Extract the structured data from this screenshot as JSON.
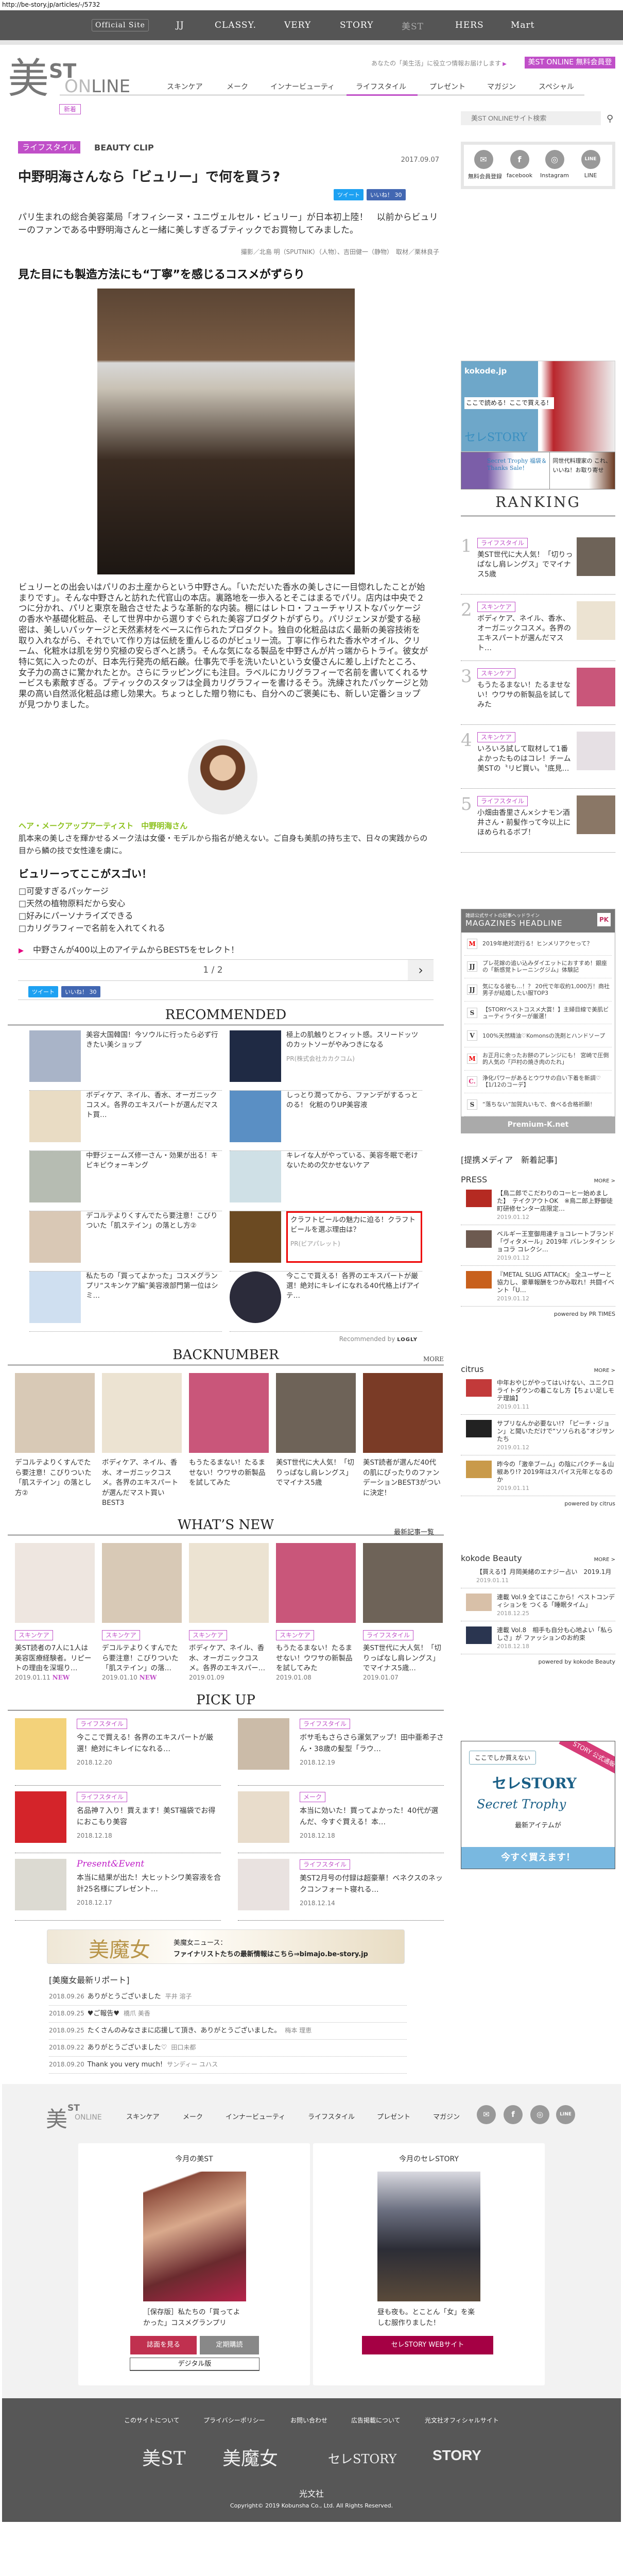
{
  "url": "http://be-story.jp/articles/-/5732",
  "topbar": {
    "official": "Official Site",
    "sites": [
      "JJ",
      "CLASSY.",
      "VERY",
      "STORY",
      "美ST",
      "HERS",
      "Mart"
    ]
  },
  "header": {
    "logo": {
      "bi": "美",
      "st": "ST",
      "on": "ON",
      "line": "LINE"
    },
    "tagline": "あなたの「美生活」に役立つ情報お届けします",
    "register": "美ST ONLINE 無料会員登録",
    "nav": [
      "スキンケア",
      "メーク",
      "インナービューティ",
      "ライフスタイル",
      "プレゼント",
      "マガジン",
      "スペシャル"
    ],
    "active_nav": "ライフスタイル",
    "new_tag": "新着",
    "search_placeholder": "美ST ONLINEサイト検索"
  },
  "social": [
    {
      "icon": "✉",
      "label": "無料会員登録"
    },
    {
      "icon": "f",
      "label": "facebook"
    },
    {
      "icon": "◎",
      "label": "Instagram"
    },
    {
      "icon": "LINE",
      "label": "LINE"
    }
  ],
  "article": {
    "category": "ライフスタイル",
    "series": "BEAUTY CLIP",
    "date": "2017.09.07",
    "title": "中野明海さんなら「ビュリー」で何を買う?",
    "tweet": "ツイート",
    "like": "いいね！ 30",
    "lead": "パリ生まれの総合美容薬局「オフィシーヌ・ユニヴェルセル・ビュリー」が日本初上陸！　以前からビュリーのファンである中野明海さんと一緒に美しすぎるブティックでお買物してみました。",
    "credit": "撮影／北島 明（SPUTNIK）（人物）、吉田健一（静物）　取材／栗林良子",
    "h2": "見た目にも製造方法にも“丁寧”を感じるコスメがずらり",
    "body": "ビュリーとの出会いはパリのお土産からという中野さん。「いただいた香水の美しさに一目惚れしたことが始まりです」。そんな中野さんと訪れた代官山の本店。裏路地を一歩入るとそこはまるでパリ。店内は中央で２つに分かれ、パリと東京を融合させたような革新的な内装。棚にはレトロ・フューチャリストなパッケージの香水や基礎化粧品、そして世界中から選りすぐられた美容プロダクトがずらり。パリジェンヌが愛する秘密は、美しいパッケージと天然素材をベースに作られたプロダクト。独自の化粧品は広く最新の美容技術を取り入れながら、それでいて作り方は伝統を重んじるのがビュリー流。丁寧に作られた香水やオイル、クリーム、化粧水は肌を労り究極の安らぎへと誘う。そんな気になる製品を中野さんが片っ端からトライ。彼女が特に気に入ったのが、日本先行発売の紙石鹸。仕事先で手を洗いたいという女優さんに差し上げたところ、女子力の高さに驚かれたとか。さらにラッピングにも注目。ラベルにカリグラフィーで名前を書いてくれるサービスも素敵すぎる。ブティックのスタッフは全員カリグラフィーを書けるそう。洗練されたパッケージと効果の高い自然派化粧品は癒し効果大。ちょっとした贈り物にも、自分へのご褒美にも、新しい定番ショップが見つかりました。",
    "profile_name": "ヘア・メークアップアーティスト　中野明海さん",
    "profile_desc": "肌本来の美しさを輝かせるメーク法は女優・モデルから指名が絶えない。ご自身も美肌の持ち主で、日々の実践からの目から鱗の技で女性達を虜に。",
    "h3": "ビュリーってここがスゴい！",
    "checklist": [
      "□可愛すぎるパッケージ",
      "□天然の植物原料だから安心",
      "□好みにパーソナライズできる",
      "□カリグラフィーで名前を入れてくれる"
    ],
    "next_link": "中野さんが400以上のアイテムからBEST5をセレクト！",
    "pager": "1 / 2",
    "next_icon": "›"
  },
  "recommended": {
    "title": "RECOMMENDED",
    "items": [
      {
        "t": "美容大国韓国！今ソウルに行ったら必ず行きたい美ショップ",
        "c": "#a9b4c8"
      },
      {
        "t": "極上の肌触りとフィット感。スリードッツのカットソーがやみつきになる",
        "pr": "PR(株式会社カカクコム)",
        "c": "#1f2a44"
      },
      {
        "t": "ボディケア、ネイル、香水、オーガニックコスメ。各界のエキスパートが選んだマスト買…",
        "c": "#e9dcc4"
      },
      {
        "t": "しっとり潤ってから、ファンデがするっとのる！ 化粧のりUP美容液",
        "c": "#5a8fc4"
      },
      {
        "t": "中野ジェームズ修一さん・効果が出る！キビキビウォーキング",
        "c": "#b6bcb2"
      },
      {
        "t": "キレイな人がやっている、美容冬眠で老けないための欠かせないケア",
        "c": "#cfe0e6"
      },
      {
        "t": "デコルテよりくすんでたら要注意！こびりついた「肌ステイン」の落とし方②",
        "c": "#d9c8b5"
      },
      {
        "t": "クラフトビールの魅力に迫る！クラフトビールを選ぶ理由は？",
        "pr": "PR(ビアパレット)",
        "c": "#6b4a22",
        "highlight": true
      },
      {
        "t": "私たちの「買ってよかった」コスメグランプリ“スキンケア編”美容液部門第一位はシミ…",
        "c": "#cfdff0"
      },
      {
        "t": "今ここで買える！各界のエキスパートが厳選！絶対にキレイになれる40代格上げアイテ…",
        "c": "#2b2b3a",
        "round": true
      }
    ],
    "by": "Recommended by",
    "by_brand": "LOGLY"
  },
  "backnumber": {
    "title": "BACKNUMBER",
    "more": "MORE",
    "items": [
      {
        "t": "デコルテよりくすんでたら要注意！こびりついた「肌ステイン」の落とし方②",
        "c": "#d8c9b6"
      },
      {
        "t": "ボディケア、ネイル、香水、オーガニックコスメ。各界のエキスパートが選んだマスト買いBEST3",
        "c": "#ece3d2"
      },
      {
        "t": "もうたるまない！たるませない！ウワサの新製品を試してみた",
        "c": "#c9567a"
      },
      {
        "t": "美ST世代に大人気！「切りっぱなし肩レングス」でマイナス5歳",
        "c": "#6e6358"
      },
      {
        "t": "美ST読者が選んだ40代の肌にぴったりのファンデーションBEST3がついに決定！",
        "c": "#7a3b26"
      }
    ]
  },
  "whatsnew": {
    "title": "WHAT’S NEW",
    "more": "最新記事一覧",
    "new_label": "NEW",
    "items": [
      {
        "tag": "スキンケア",
        "t": "美ST読者の7人に1人は美容医療経験者。リピートの理由を深堀り…",
        "d": "2019.01.11",
        "isnew": true,
        "c": "#eee6e0"
      },
      {
        "tag": "スキンケア",
        "t": "デコルテよりくすんでたら要注意！こびりついた「肌ステイン」の落…",
        "d": "2019.01.10",
        "isnew": true,
        "c": "#d8c9b6"
      },
      {
        "tag": "スキンケア",
        "t": "ボディケア、ネイル、香水、オーガニックコスメ。各界のエキスパー…",
        "d": "2019.01.09",
        "c": "#ece3d2"
      },
      {
        "tag": "スキンケア",
        "t": "もうたるまない！たるませない！ウワサの新製品を試してみた",
        "d": "2019.01.08",
        "c": "#c9567a"
      },
      {
        "tag": "ライフスタイル",
        "t": "美ST世代に大人気！「切りっぱなし肩レングス」でマイナス5歳…",
        "d": "2019.01.07",
        "c": "#6e6358"
      }
    ]
  },
  "pickup": {
    "title": "PICK UP",
    "items": [
      {
        "tag": "ライフスタイル",
        "t": "今ここで買える！各界のエキスパートが厳選！絶対にキレイになれる…",
        "d": "2018.12.20",
        "c": "#f3d27a"
      },
      {
        "tag": "ライフスタイル",
        "t": "ボサ毛もさらさら運気アップ！田中亜希子さん・38歳の髪型「ラウ…",
        "d": "2018.12.19",
        "c": "#cbbba8"
      },
      {
        "tag": "ライフスタイル",
        "t": "名品神７入り！買えます！美ST福袋でお得におこもり美容",
        "d": "2018.12.18",
        "c": "#d4242a"
      },
      {
        "tag": "メーク",
        "t": "本当に効いた！買ってよかった！40代が選んだ、今すぐ買える！本…",
        "d": "2018.12.18",
        "c": "#e8dccb"
      },
      {
        "pe": "Present&Event",
        "t": "本当に結果が出た！大ヒットシワ美容液を合計25名様にプレゼント…",
        "d": "2018.12.17",
        "c": "#dcdad2"
      },
      {
        "tag": "ライフスタイル",
        "t": "美ST2月号の付録は超豪華！ベネクスのネックコンフォート寝れる…",
        "d": "2018.12.14",
        "c": "#e9e2e0"
      }
    ]
  },
  "bimajo": {
    "logo": "美魔女",
    "news": "美魔女ニュース：",
    "link": "ファイナリストたちの最新情報はこちら⇒bimajo.be-story.jp"
  },
  "reports": {
    "title": "[美魔女最新リポート]",
    "items": [
      {
        "d": "2018.09.26",
        "t": "ありがとうございました",
        "a": "平井 溶子"
      },
      {
        "d": "2018.09.25",
        "t": "♥ご報告♥",
        "a": "橋爪 美香"
      },
      {
        "d": "2018.09.25",
        "t": "たくさんのみなさまに応援して頂き、ありがとうございました。",
        "a": "梅本 理恵"
      },
      {
        "d": "2018.09.22",
        "t": "ありがとうございました♡",
        "a": "田口未都"
      },
      {
        "d": "2018.09.20",
        "t": "Thank you very much!",
        "a": "サンディー ユハス"
      }
    ]
  },
  "sidebar": {
    "ad1": {
      "k": "kokode.jp",
      "k2": "ここで読める！ここで買える！",
      "k3": "セレSTORY"
    },
    "ad2": {
      "a1": "Secret Trophy 福袋＆Thanks Sale！",
      "a2": "同世代料理家の これ、いいね！お取り寄せ"
    },
    "ranking_title": "RANKING",
    "ranking": [
      {
        "n": "1",
        "tag": "ライフスタイル",
        "t": "美ST世代に大人気！「切りっぱなし肩レングス」でマイナス5歳",
        "c": "#6e6358"
      },
      {
        "n": "2",
        "tag": "スキンケア",
        "t": "ボディケア、ネイル、香水、オーガニックコスメ。各界のエキスパートが選んだマスト…",
        "c": "#ece3d2"
      },
      {
        "n": "3",
        "tag": "スキンケア",
        "t": "もうたるまない！たるませない！ウワサの新製品を試してみた",
        "c": "#c9567a"
      },
      {
        "n": "4",
        "tag": "スキンケア",
        "t": "いろいろ試して取材して1番よかったものはコレ！チーム美STの〝リピ買い〟〝底見…",
        "c": "#e6e0e4"
      },
      {
        "n": "5",
        "tag": "ライフスタイル",
        "t": "小畑由香里さん×シナモン酒井さん・前髪作って今以上にほめられるボブ！",
        "c": "#8a7766"
      }
    ],
    "magazines": {
      "sub": "雑誌公式サイトの記事ヘッドライン",
      "title": "MAGAZINES HEADLINE",
      "badge": "PK",
      "items": [
        {
          "ic": "M",
          "col": "#e00",
          "t": "2019年絶対流行る！ヒンメリアクセって？"
        },
        {
          "ic": "JJ",
          "col": "#333",
          "t": "プレ花嫁の追い込みダイエットにおすすめ！銀座の「新感覚トレーニングジム」体験記"
        },
        {
          "ic": "JJ",
          "col": "#333",
          "t": "気になる彼も…！？ 20代で年収約1,000万！商社男子が結婚したい服TOP3"
        },
        {
          "ic": "S",
          "col": "#333",
          "t": "【STORYベストコスメ大賞！】主婦目線で美肌ビューティライターが厳選！"
        },
        {
          "ic": "V",
          "col": "#333",
          "t": "100%天然精油♡Komonsの洗剤とハンドソープ"
        },
        {
          "ic": "M",
          "col": "#e00",
          "t": "お正月に余ったお餅のアレンジにも！ 宮崎で圧倒的人気の「戸村の焼き肉のたれ」"
        },
        {
          "ic": "C.",
          "col": "#e0307a",
          "t": "浄化パワーがあるとウワサの白い下着を新調♡ 【1/12のコーデ】"
        },
        {
          "ic": "S",
          "col": "#333",
          "t": "“落ちない”加賀丸いもで、食べる合格祈願！"
        }
      ],
      "footer": "Premium-K.net"
    },
    "media_title": "[提携メディア　新着記事]",
    "media": [
      {
        "name": "PRESS",
        "more": "MORE >",
        "powered": "powered by PR TIMES",
        "items": [
          {
            "t": "【鳥二郎でこだわりのコーヒー始めました】　テイクアウトOK　※鳥二郎上野御徒町研修センター店限定…",
            "d": "2019.01.12",
            "c": "#b52a22"
          },
          {
            "t": "ベルギー王室御用達チョコレートブランド「ヴィタメール」2019年 バレンタイン ショコラ コレクシ…",
            "d": "2019.01.12",
            "c": "#6d5a50"
          },
          {
            "t": "『METAL SLUG ATTACK』 全ユーザーと協力し、豪華報酬をつかみ取れ！共闘イベント「U…",
            "d": "2019.01.12",
            "c": "#c8601c"
          }
        ]
      },
      {
        "name": "citrus",
        "more": "MORE >",
        "powered": "powered by citrus",
        "items": [
          {
            "t": "中年おやじがやってはいけない、ユニクロライトダウンの着こなし方【ちょい足しモテ理論】",
            "d": "2019.01.11",
            "c": "#c23a3a"
          },
          {
            "t": "サプリなんか必要ない!? 「ピーチ・ジョン」と聞いただけで“ソソられる”オジサンたち",
            "d": "2019.01.12",
            "c": "#222"
          },
          {
            "t": "昨今の「激辛ブーム」の陰にパクチー＆山椒あり!? 2019年はスパイス元年となるのか",
            "d": "2019.01.11",
            "c": "#c99a4a"
          }
        ]
      },
      {
        "name": "kokode Beauty",
        "more": "MORE >",
        "powered": "powered by kokode Beauty",
        "items": [
          {
            "t": "【買える!】月岡美緒のエナジー占い　2019.1月",
            "d": "2019.01.11",
            "noimg": true
          },
          {
            "t": "連載 Vol.9 全てはここから！ベストコンディションを つくる「睡眠タイム」",
            "d": "2018.12.25",
            "c": "#d8c0a8"
          },
          {
            "t": "連載 Vol.8　相手も自分も心地よい「私らしさ」が ファッションのお約束",
            "d": "2018.12.18",
            "c": "#2a3550"
          }
        ]
      }
    ],
    "bigad": {
      "q": "ここでしか買えない",
      "corner": "STORY 公式通販",
      "s1": "セレSTORY",
      "s2": "Secret Trophy",
      "s3": "最新アイテムが",
      "s4": "今すぐ買えます！"
    }
  },
  "footer": {
    "nav": [
      "スキンケア",
      "メーク",
      "インナービューティ",
      "ライフスタイル",
      "プレゼント",
      "マガジン"
    ],
    "social": [
      "✉",
      "f",
      "◎",
      "LINE"
    ],
    "card1": {
      "title": "今月の美ST",
      "caption": "［保存版］私たちの「買ってよかった」コスメグランプリ",
      "btn1": "誌面を見る",
      "btn2": "定期購読",
      "btn3": "デジタル版"
    },
    "card2": {
      "title": "今月のセレSTORY",
      "caption": "昼も夜も。とことん「女」を楽しむ服作りました！",
      "btn": "セレSTORY WEBサイト"
    },
    "links": [
      "このサイトについて",
      "プライバシーポリシー",
      "お問い合わせ",
      "広告掲載について",
      "光文社オフィシャルサイト"
    ],
    "logos": [
      "美ST",
      "美魔女",
      "セレSTORY",
      "STORY"
    ],
    "publisher": "光文社",
    "copyright": "Copyright© 2019 Kobunsha Co., Ltd. All Rights Reserved."
  },
  "colors": {
    "accent": "#c04fc8",
    "green": "#8dc21f",
    "pink": "#e4007f",
    "dark": "#555555"
  }
}
